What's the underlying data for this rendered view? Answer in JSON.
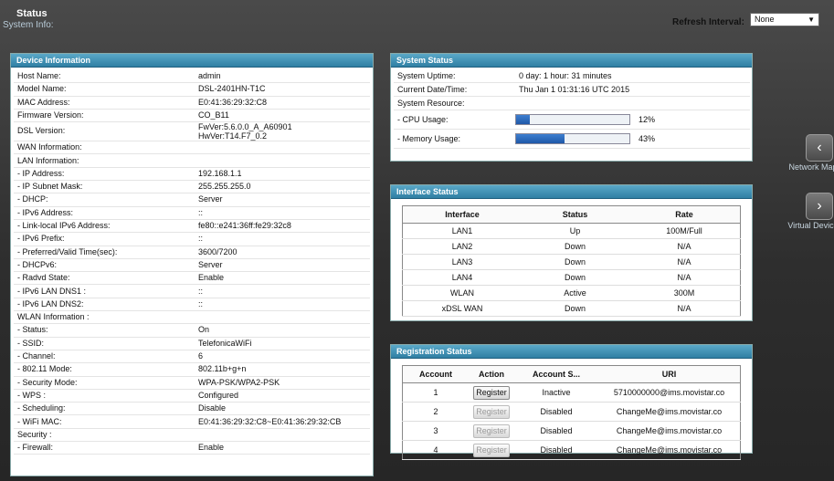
{
  "header": {
    "title": "Status",
    "subtitle": "System Info:"
  },
  "refresh": {
    "label": "Refresh Interval:",
    "value": "None"
  },
  "device": {
    "title": "Device Information",
    "rows": [
      {
        "k": "Host Name:",
        "v": "admin"
      },
      {
        "k": "Model Name:",
        "v": "DSL-2401HN-T1C"
      },
      {
        "k": "MAC Address:",
        "v": "E0:41:36:29:32:C8"
      },
      {
        "k": "Firmware Version:",
        "v": "CO_B11"
      },
      {
        "k": "DSL Version:",
        "v": "FwVer:5.6.0.0_A_A60901\nHwVer:T14.F7_0.2"
      },
      {
        "k": "WAN Information:",
        "v": ""
      },
      {
        "k": "LAN Information:",
        "v": ""
      },
      {
        "k": "- IP Address:",
        "v": "192.168.1.1"
      },
      {
        "k": "- IP Subnet Mask:",
        "v": "255.255.255.0"
      },
      {
        "k": "- DHCP:",
        "v": "Server"
      },
      {
        "k": "- IPv6 Address:",
        "v": "::"
      },
      {
        "k": "- Link-local IPv6 Address:",
        "v": "fe80::e241:36ff:fe29:32c8"
      },
      {
        "k": "- IPv6 Prefix:",
        "v": "::"
      },
      {
        "k": "- Preferred/Valid Time(sec):",
        "v": "3600/7200"
      },
      {
        "k": "- DHCPv6:",
        "v": "Server"
      },
      {
        "k": "- Radvd State:",
        "v": "Enable"
      },
      {
        "k": "- IPv6 LAN DNS1 :",
        "v": "::"
      },
      {
        "k": "- IPv6 LAN DNS2:",
        "v": "::"
      },
      {
        "k": "WLAN Information :",
        "v": ""
      },
      {
        "k": "- Status:",
        "v": "On"
      },
      {
        "k": "- SSID:",
        "v": "TelefonicaWiFi"
      },
      {
        "k": "- Channel:",
        "v": "6"
      },
      {
        "k": "- 802.11 Mode:",
        "v": "802.11b+g+n"
      },
      {
        "k": "- Security Mode:",
        "v": "WPA-PSK/WPA2-PSK"
      },
      {
        "k": "- WPS :",
        "v": "Configured"
      },
      {
        "k": "- Scheduling:",
        "v": "Disable"
      },
      {
        "k": "- WiFi MAC:",
        "v": "E0:41:36:29:32:C8~E0:41:36:29:32:CB"
      },
      {
        "k": "Security :",
        "v": ""
      },
      {
        "k": "- Firewall:",
        "v": "Enable"
      }
    ]
  },
  "system": {
    "title": "System Status",
    "uptime_label": "System Uptime:",
    "uptime": "0 day: 1 hour: 31 minutes",
    "date_label": "Current Date/Time:",
    "date": "Thu Jan 1 01:31:16 UTC 2015",
    "resource_label": "System Resource:",
    "cpu_label": "- CPU Usage:",
    "cpu_pct": "12%",
    "cpu_value": 12,
    "mem_label": "- Memory Usage:",
    "mem_pct": "43%",
    "mem_value": 43
  },
  "interface": {
    "title": "Interface Status",
    "headers": [
      "Interface",
      "Status",
      "Rate"
    ],
    "rows": [
      [
        "LAN1",
        "Up",
        "100M/Full"
      ],
      [
        "LAN2",
        "Down",
        "N/A"
      ],
      [
        "LAN3",
        "Down",
        "N/A"
      ],
      [
        "LAN4",
        "Down",
        "N/A"
      ],
      [
        "WLAN",
        "Active",
        "300M"
      ],
      [
        "xDSL WAN",
        "Down",
        "N/A"
      ]
    ]
  },
  "registration": {
    "title": "Registration Status",
    "headers": [
      "Account",
      "Action",
      "Account S...",
      "URI"
    ],
    "rows": [
      {
        "account": "1",
        "action": "Register",
        "enabled": true,
        "status": "Inactive",
        "uri": "5710000000@ims.movistar.co"
      },
      {
        "account": "2",
        "action": "Register",
        "enabled": false,
        "status": "Disabled",
        "uri": "ChangeMe@ims.movistar.co"
      },
      {
        "account": "3",
        "action": "Register",
        "enabled": false,
        "status": "Disabled",
        "uri": "ChangeMe@ims.movistar.co"
      },
      {
        "account": "4",
        "action": "Register",
        "enabled": false,
        "status": "Disabled",
        "uri": "ChangeMe@ims.movistar.co"
      }
    ]
  },
  "nav": {
    "network_map": "Network Map",
    "virtual_device": "Virtual Device",
    "network_map_icon": "chevron-left-icon",
    "virtual_device_icon": "chevron-right-icon"
  }
}
